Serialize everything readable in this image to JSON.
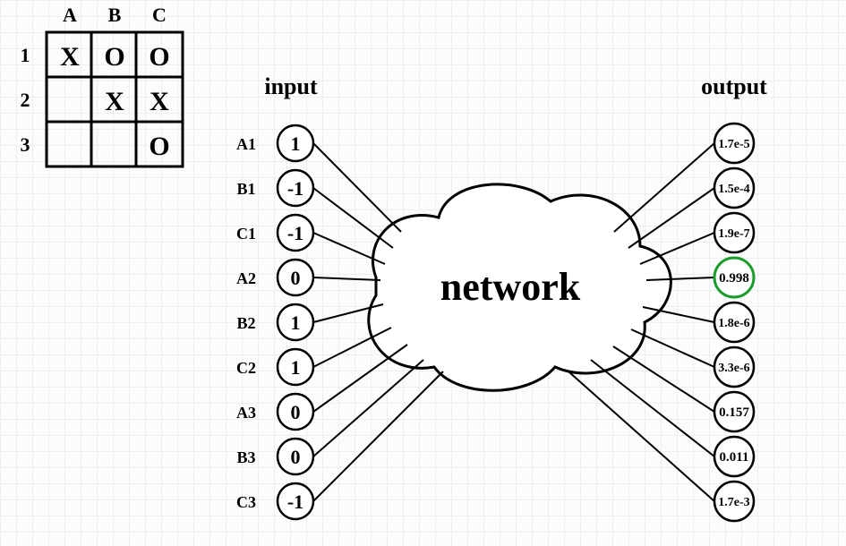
{
  "table": {
    "cols": [
      "A",
      "B",
      "C"
    ],
    "rows": [
      "1",
      "2",
      "3"
    ],
    "cells": {
      "a1": "X",
      "b1": "O",
      "c1": "O",
      "a2": "",
      "b2": "X",
      "c2": "X",
      "a3": "",
      "b3": "",
      "c3": "O"
    }
  },
  "headers": {
    "input": "input",
    "output": "output",
    "network": "network"
  },
  "inputs": [
    {
      "label": "A1",
      "value": "1"
    },
    {
      "label": "B1",
      "value": "-1"
    },
    {
      "label": "C1",
      "value": "-1"
    },
    {
      "label": "A2",
      "value": "0"
    },
    {
      "label": "B2",
      "value": "1"
    },
    {
      "label": "C2",
      "value": "1"
    },
    {
      "label": "A3",
      "value": "0"
    },
    {
      "label": "B3",
      "value": "0"
    },
    {
      "label": "C3",
      "value": "-1"
    }
  ],
  "outputs": [
    {
      "value": "1.7e-5",
      "highlight": false
    },
    {
      "value": "1.5e-4",
      "highlight": false
    },
    {
      "value": "1.9e-7",
      "highlight": false
    },
    {
      "value": "0.998",
      "highlight": true
    },
    {
      "value": "1.8e-6",
      "highlight": false
    },
    {
      "value": "3.3e-6",
      "highlight": false
    },
    {
      "value": "0.157",
      "highlight": false
    },
    {
      "value": "0.011",
      "highlight": false
    },
    {
      "value": "1.7e-3",
      "highlight": false
    }
  ],
  "colors": {
    "highlight": "#1a9b2a"
  }
}
